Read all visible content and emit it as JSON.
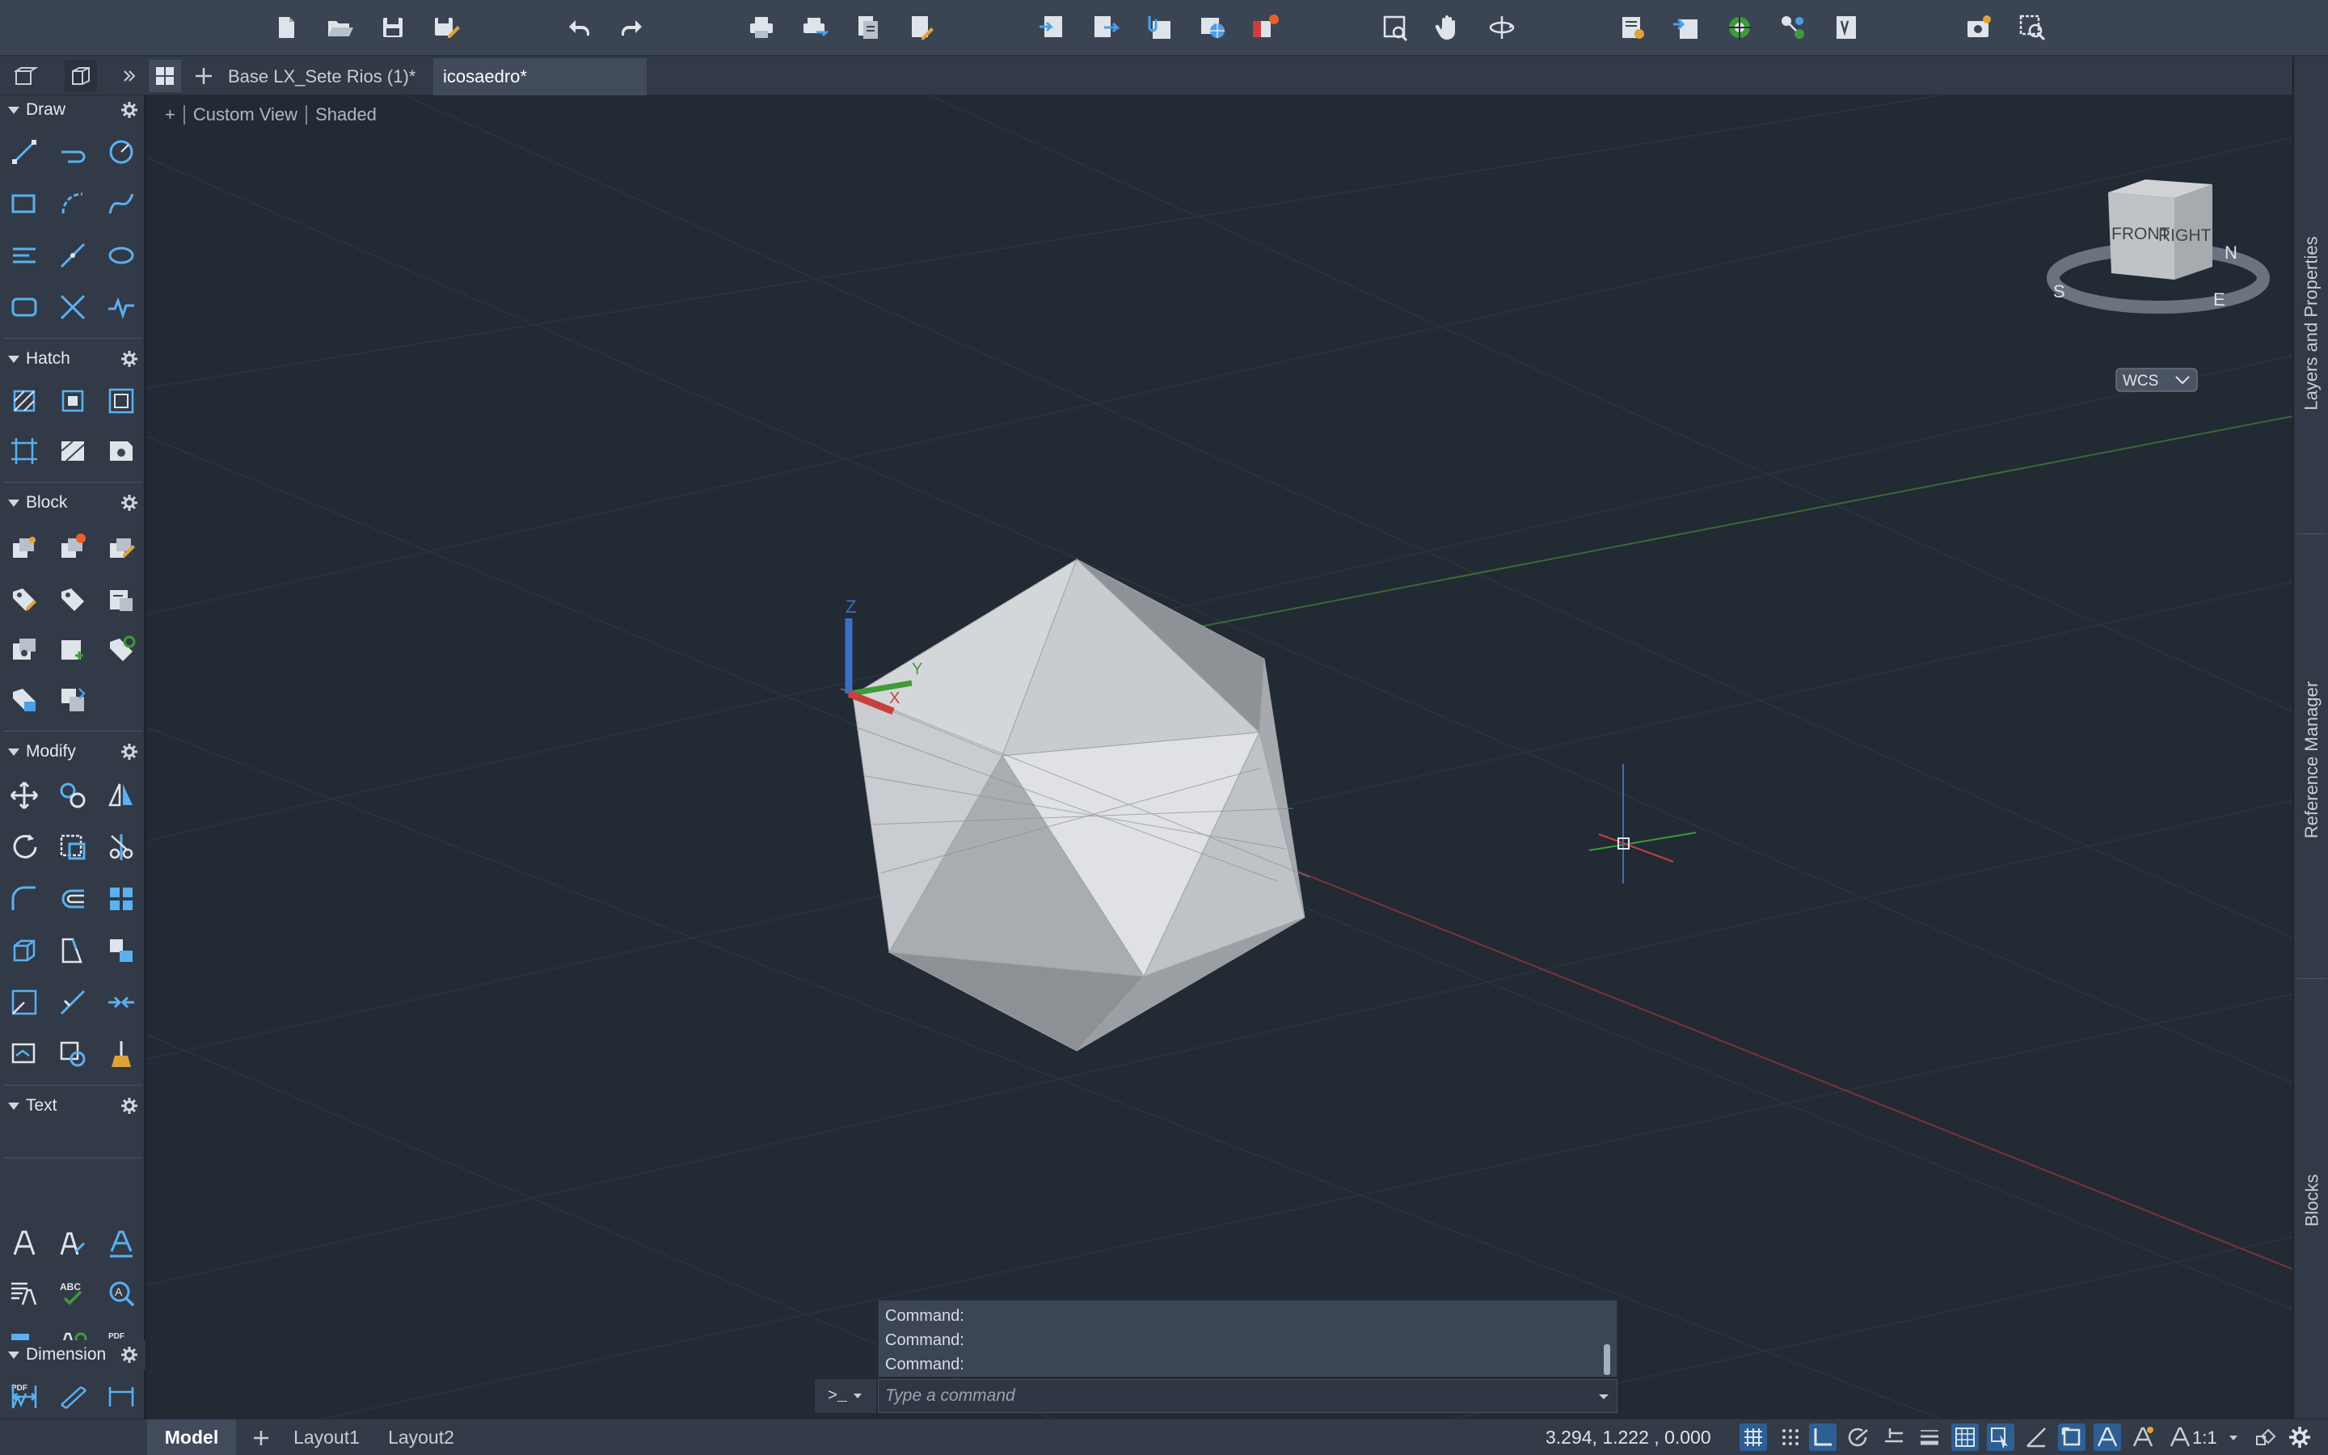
{
  "toolbar": {
    "groups": [
      "file",
      "undo-redo",
      "plot-publish",
      "view-navigation",
      "layers",
      "utilities"
    ]
  },
  "tabs": {
    "documents": [
      {
        "label": "Base LX_Sete Rios (1)*",
        "active": false
      },
      {
        "label": "icosaedro*",
        "active": true
      }
    ]
  },
  "palette": {
    "sections": [
      {
        "title": "Draw"
      },
      {
        "title": "Hatch"
      },
      {
        "title": "Block"
      },
      {
        "title": "Modify"
      },
      {
        "title": "Text"
      },
      {
        "title": "Dimension"
      }
    ]
  },
  "viewport": {
    "view_name": "Custom View",
    "visual_style": "Shaded",
    "plus_label": "+",
    "ucs_axes": {
      "z": "Z",
      "y": "Y",
      "x": "X"
    },
    "viewcube": {
      "front": "FRONT",
      "right": "RIGHT",
      "compass": [
        "S",
        "E",
        "N"
      ],
      "coord_system": "WCS"
    }
  },
  "right_panels": [
    "Layers and Properties",
    "Reference Manager",
    "Blocks"
  ],
  "command": {
    "history": [
      "Command:",
      "Command:",
      "Command:"
    ],
    "prompt_symbol": ">_",
    "placeholder": "Type a command"
  },
  "status": {
    "layouts": [
      {
        "label": "Model",
        "active": true
      },
      {
        "label": "Layout1",
        "active": false
      },
      {
        "label": "Layout2",
        "active": false
      }
    ],
    "coordinates": "3.294,  1.222 , 0.000",
    "scale": "1:1"
  },
  "colors": {
    "accent": "#4a9fe8",
    "x_axis": "#c8403e",
    "y_axis": "#3f9a3a",
    "z_axis": "#3a6fc4",
    "orange_badge": "#e8612c"
  }
}
